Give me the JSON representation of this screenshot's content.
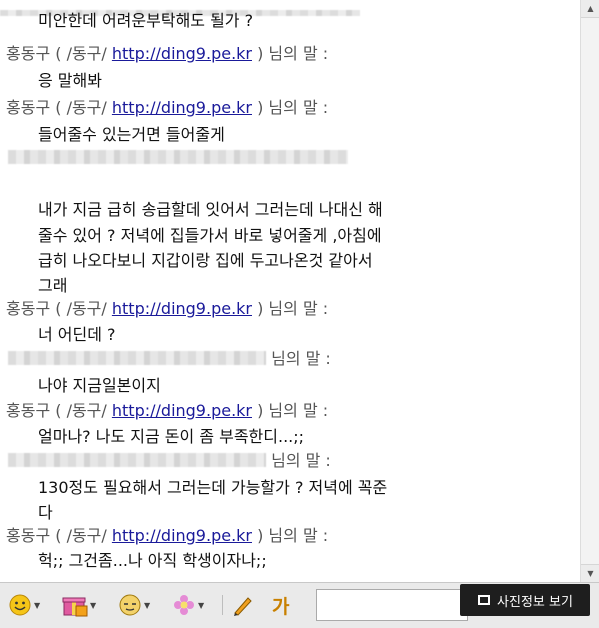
{
  "chat": {
    "link": "http://ding9.pe.kr",
    "messages": [
      {
        "type": "msg",
        "text": "미안한데 어려운부탁해도 될가 ?"
      },
      {
        "type": "sender",
        "name": "홍동구 ( /동구/",
        "suffix": ") 님의 말 :"
      },
      {
        "type": "msg",
        "text": "응 말해봐"
      },
      {
        "type": "sender",
        "name": "홍동구 ( /동구/",
        "suffix": ") 님의 말 :"
      },
      {
        "type": "msg",
        "text": "들어줄수 있는거면 들어줄게"
      },
      {
        "type": "msg",
        "text": "내가 지금 급히 송급할데 잇어서 그러는데 나대신 해"
      },
      {
        "type": "msg",
        "text": "줄수 있어 ? 저녁에 집들가서 바로 넣어줄게 ,아침에"
      },
      {
        "type": "msg",
        "text": "급히 나오다보니 지갑이랑 집에 두고나온것 같아서"
      },
      {
        "type": "msg",
        "text": "그래"
      },
      {
        "type": "sender",
        "name": "홍동구 ( /동구/",
        "suffix": ") 님의 말 :"
      },
      {
        "type": "msg",
        "text": "너 어딘데 ?"
      },
      {
        "type": "sender2",
        "suffix": "님의 말 :"
      },
      {
        "type": "msg",
        "text": "나야 지금일본이지"
      },
      {
        "type": "sender",
        "name": "홍동구 ( /동구/",
        "suffix": ") 님의 말 :"
      },
      {
        "type": "msg",
        "text": "얼마나? 나도 지금 돈이 좀 부족한디...;;"
      },
      {
        "type": "sender2",
        "suffix": "님의 말 :"
      },
      {
        "type": "msg",
        "text": "130정도 필요해서 그러는데 가능할가 ? 저녁에 꼭준"
      },
      {
        "type": "msg",
        "text": "다"
      },
      {
        "type": "sender",
        "name": "홍동구 ( /동구/",
        "suffix": ") 님의 말 :"
      },
      {
        "type": "msg",
        "text": "헉;; 그건좀...나 아직 학생이자나;;"
      }
    ]
  },
  "toolbar": {
    "photo_info_label": "사진정보 보기",
    "font_label": "가"
  },
  "icons": [
    "emoticon-icon",
    "gift-icon",
    "character-icon",
    "flower-icon",
    "pen-icon",
    "font-icon"
  ],
  "colors": {
    "link": "#1a1a9a",
    "sender": "#555555",
    "photo_button_bg": "#1e1e1e"
  }
}
